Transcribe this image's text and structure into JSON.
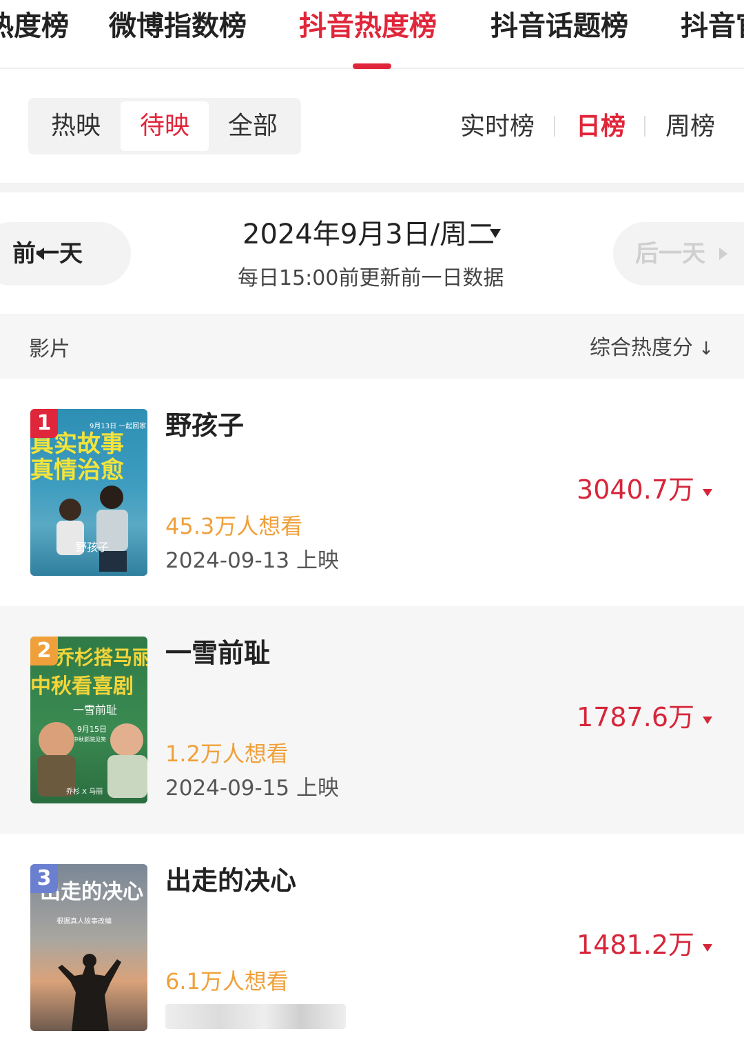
{
  "top_tabs": [
    "热度榜",
    "微博指数榜",
    "抖音热度榜",
    "抖音话题榜",
    "抖音官"
  ],
  "active_tab_index": 2,
  "filter": {
    "options": [
      "热映",
      "待映",
      "全部"
    ],
    "active": "待映"
  },
  "range": {
    "options": [
      "实时榜",
      "日榜",
      "周榜"
    ],
    "active": "日榜"
  },
  "date": {
    "prev_label": "前一天",
    "current": "2024年9月3日/周二",
    "note": "每日15:00前更新前一日数据",
    "next_label": "后一天"
  },
  "table": {
    "col_movie": "影片",
    "col_score": "综合热度分"
  },
  "movies": [
    {
      "rank": "1",
      "title": "野孩子",
      "want": "45.3万人想看",
      "release": "2024-09-13 上映",
      "heat": "3040.7万",
      "poster_lines": [
        "9月13日 一起回家",
        "真实故事",
        "真情治愈",
        "野孩子"
      ]
    },
    {
      "rank": "2",
      "title": "一雪前耻",
      "want": "1.2万人想看",
      "release": "2024-09-15 上映",
      "heat": "1787.6万",
      "poster_lines": [
        "乔杉搭马丽",
        "中秋看喜剧",
        "一雪前耻",
        "9月15日",
        "中秋影院见笑",
        "乔杉 X 马丽"
      ]
    },
    {
      "rank": "3",
      "title": "出走的决心",
      "want": "6.1万人想看",
      "release": "",
      "heat": "1481.2万",
      "poster_lines": [
        "出走的决心",
        "根据真人故事改编"
      ]
    }
  ],
  "colors": {
    "accent": "#e0263a",
    "want": "#f0a03a",
    "rank1": "#e0263a",
    "rank2": "#f0a03a",
    "rank3": "#6b7fd0"
  }
}
